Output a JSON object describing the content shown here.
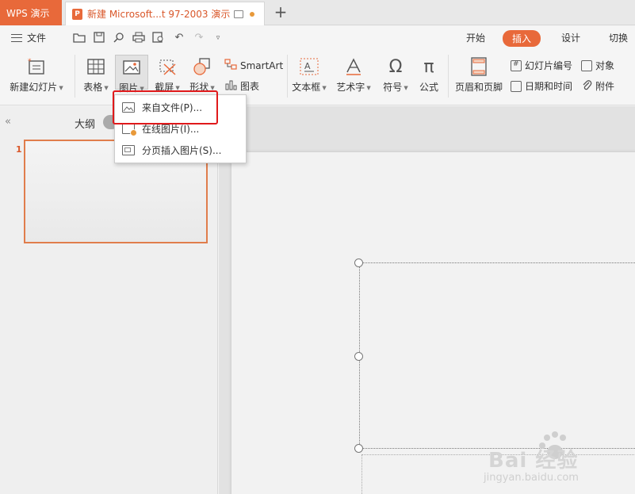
{
  "tabs": {
    "app_tab": "WPS 演示",
    "doc_tab": "新建 Microsoft...t 97-2003 演示",
    "add_tab": "+"
  },
  "menu": {
    "file": "文件",
    "ribbon_tabs": [
      "开始",
      "插入",
      "设计",
      "切换"
    ],
    "active_tab": "插入"
  },
  "ribbon": {
    "new_slide": "新建幻灯片",
    "table": "表格",
    "picture": "图片",
    "screenshot": "截屏",
    "shape": "形状",
    "smartart": "SmartArt",
    "chart": "图表",
    "textbox": "文本框",
    "wordart": "艺术字",
    "symbol": "符号",
    "formula": "公式",
    "header_footer": "页眉和页脚",
    "slide_number": "幻灯片编号",
    "datetime": "日期和时间",
    "object": "对象",
    "attachment": "附件"
  },
  "picture_dropdown": {
    "items": [
      {
        "label": "来自文件(P)...",
        "icon": "image-file-icon"
      },
      {
        "label": "在线图片(I)...",
        "icon": "online-image-icon"
      },
      {
        "label": "分页插入图片(S)...",
        "icon": "page-insert-image-icon"
      }
    ],
    "highlighted_index": 0
  },
  "left_panel": {
    "collapse": "«",
    "outline": "大纲",
    "slides": [
      {
        "number": "1"
      }
    ]
  },
  "watermark": {
    "brand": "Bai 经验",
    "url": "jingyan.baidu.com"
  },
  "colors": {
    "accent": "#e8693a",
    "highlight_border": "#e0191b",
    "selected_thumb_border": "#e07d4c"
  }
}
